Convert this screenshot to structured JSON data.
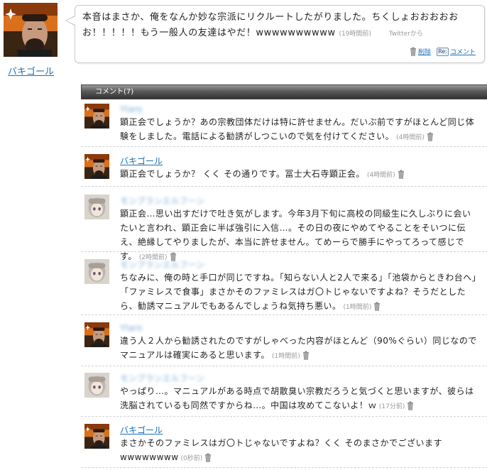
{
  "post": {
    "user_name": "バキゴール",
    "text": "本音はまさか、俺をなんか妙な宗派にリクルートしたがりました。ちくしょおおおおおお！！！！！もう一般人の友達はやだ！wwwwwwwwww",
    "time": "(19時間前)",
    "via": "Twitterから",
    "delete_label": "削除",
    "comment_label": "コメント",
    "re_icon_text": "Re:"
  },
  "comments_header": "コメント(7)",
  "comments": [
    {
      "user_name": "Ytaro",
      "avatar": "bakigoal",
      "name_blurred": true,
      "text": "顕正会でしょうか？あの宗教団体だけは特に許せません。だいぶ前ですがほとんど同じ体験をしました。電話による勧誘がしつこいので気を付けてください。",
      "time": "(4時間前)"
    },
    {
      "user_name": "バキゴール",
      "avatar": "bakigoal",
      "name_blurred": false,
      "text": "顕正会でしょうか？ くく その通りです。冨士大石寺顕正会。",
      "time": "(4時間前)"
    },
    {
      "user_name": "モンブランエルフーン",
      "avatar": "anime",
      "name_blurred": true,
      "text": "顕正会…思い出すだけで吐き気がします。今年3月下旬に高校の同級生に久しぶりに会いたいと言われ、顕正会に半ば強引に入信…。その日の夜にやめてやることをそいつに伝え、絶縁してやりましたが、本当に許せません。てめーらで勝手にやってろって感じです。",
      "time": "(2時間前)"
    },
    {
      "user_name": "モンブランエルフーン",
      "avatar": "anime",
      "name_blurred": true,
      "text": "ちなみに、俺の時と手口が同じですね。「知らない人と2人で来る」「池袋からときわ台へ」「ファミレスで食事」まさかそのファミレスはガ〇トじゃないですよね？そうだとしたら、勧誘マニュアルでもあるんでしょうね気持ち悪い。",
      "time": "(1時間前)"
    },
    {
      "user_name": "Ytaro",
      "avatar": "bakigoal",
      "name_blurred": true,
      "text": "違う人２人から勧誘されたのですがしゃべった内容がほとんど（90%ぐらい）同じなのでマニュアルは確実にあると思います。",
      "time": "(1時間前)"
    },
    {
      "user_name": "モンブランエルフーン",
      "avatar": "anime",
      "name_blurred": true,
      "text": "やっぱり…。マニュアルがある時点で胡散臭い宗教だろうと気づくと思いますが、彼らは洗脳されているも同然ですからね…。中国は攻めてこないよ！ｗ",
      "time": "(17分前)"
    },
    {
      "user_name": "バキゴール",
      "avatar": "bakigoal",
      "name_blurred": false,
      "text": "まさかそのファミレスはガ〇トじゃないですよね？くく そのまさかでございますwwwwwwww",
      "time": "(0秒前)"
    }
  ]
}
